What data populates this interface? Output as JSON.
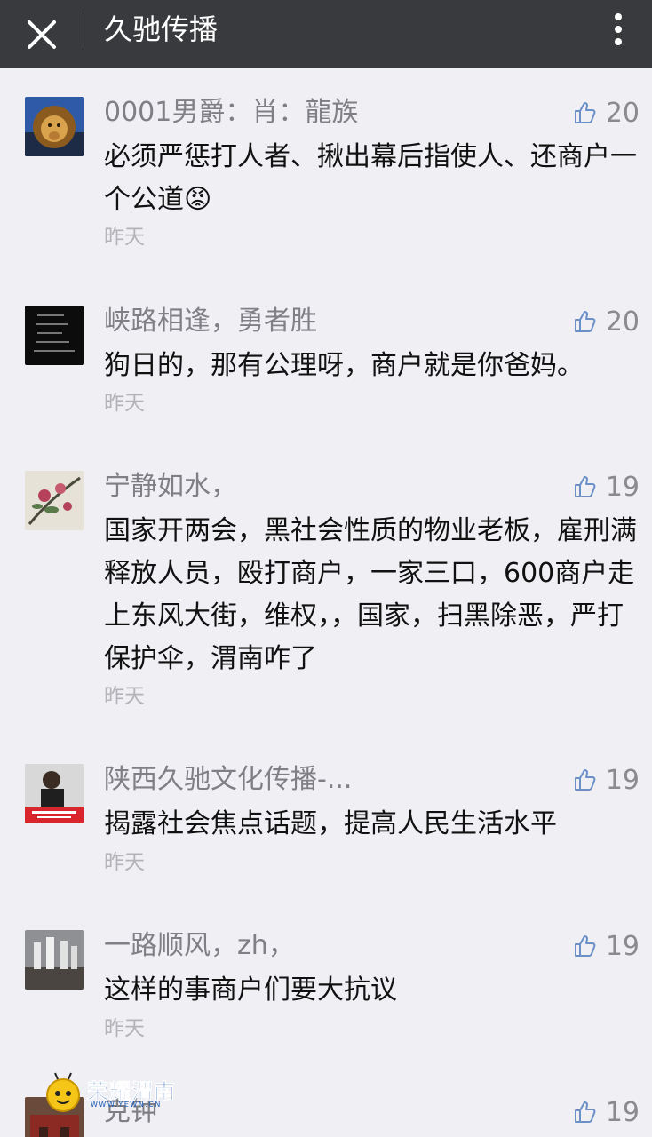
{
  "header": {
    "title": "久驰传播"
  },
  "comments": [
    {
      "nickname": "0001男爵：肖：龍族",
      "likes": "20",
      "content": "必须严惩打人者、揪出幕后指使人、还商户一个公道😡",
      "time": "昨天",
      "avatar_icon": "lion-avatar"
    },
    {
      "nickname": "峡路相逢，勇者胜",
      "likes": "20",
      "content": "狗日的，那有公理呀，商户就是你爸妈。",
      "time": "昨天",
      "avatar_icon": "dark-text-avatar"
    },
    {
      "nickname": "宁静如水，",
      "likes": "19",
      "content": "国家开两会，黑社会性质的物业老板，雇刑满释放人员，殴打商户，一家三口，600商户走上东风大街，维权，，国家，扫黑除恶，严打保护伞，渭南咋了",
      "time": "昨天",
      "avatar_icon": "flower-painting-avatar"
    },
    {
      "nickname": "陕西久驰文化传播-...",
      "likes": "19",
      "content": "揭露社会焦点话题，提高人民生活水平",
      "time": "昨天",
      "avatar_icon": "person-logo-avatar"
    },
    {
      "nickname": "一路顺风，zh，",
      "likes": "19",
      "content": "这样的事商户们要大抗议",
      "time": "昨天",
      "avatar_icon": "statue-photo-avatar"
    },
    {
      "nickname": "克钟",
      "likes": "19",
      "content": "",
      "time": "",
      "avatar_icon": "building-photo-avatar"
    }
  ],
  "watermark": {
    "text": "荣耀渭南",
    "sub": "WWW.YEWN.CN"
  },
  "colors": {
    "topbar": "#393a3e",
    "background": "#efeff4",
    "nickname": "#7f7f85",
    "like_icon": "#6b8fc7"
  }
}
